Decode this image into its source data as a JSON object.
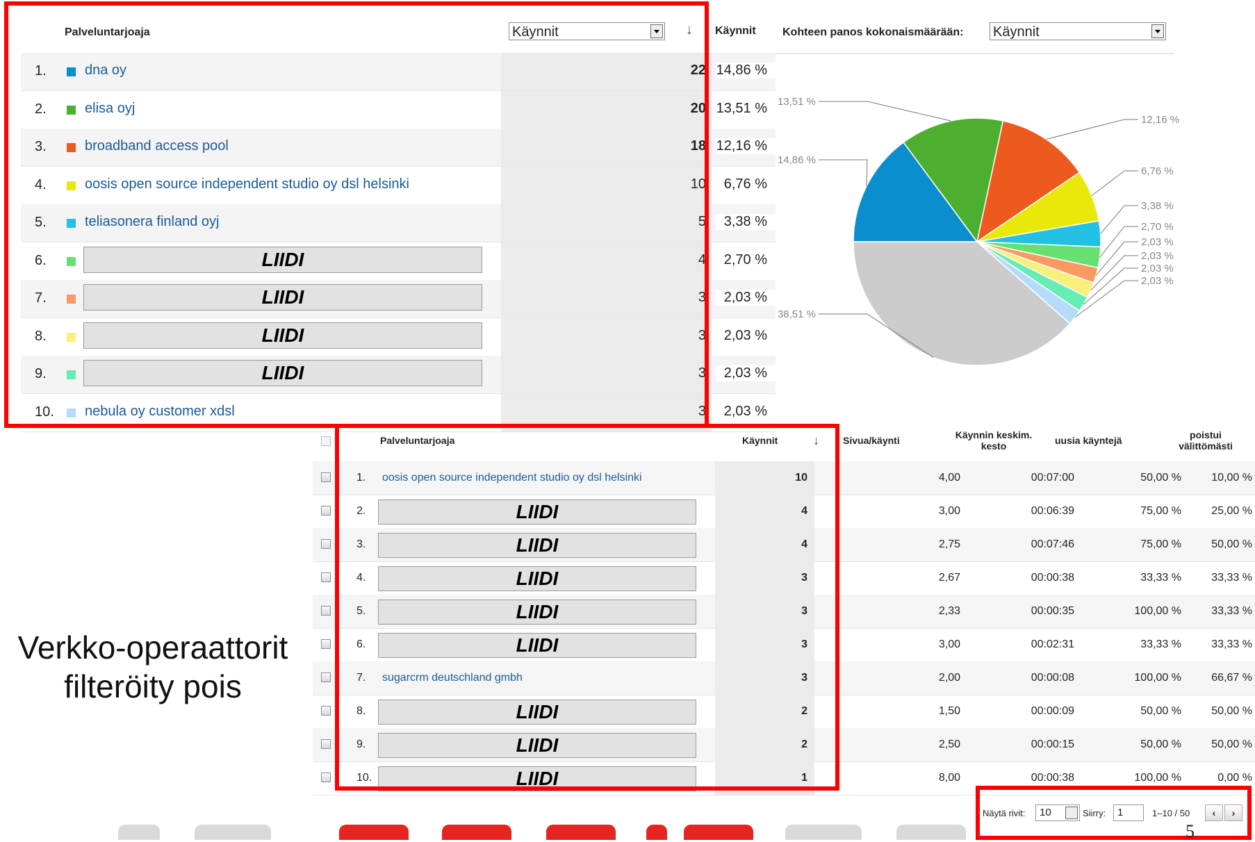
{
  "top": {
    "header": {
      "provider_col": "Palveluntarjoaja",
      "metric_select": "Käynnit",
      "visits_col": "Käynnit"
    },
    "rows": [
      {
        "num": "1.",
        "name": "dna oy",
        "visits": "22",
        "pct": "14,86 %",
        "color": "#0b8ecd",
        "hidden": false
      },
      {
        "num": "2.",
        "name": "elisa oyj",
        "visits": "20",
        "pct": "13,51 %",
        "color": "#4caf30",
        "hidden": false
      },
      {
        "num": "3.",
        "name": "broadband access pool",
        "visits": "18",
        "pct": "12,16 %",
        "color": "#ee5a1e",
        "hidden": false
      },
      {
        "num": "4.",
        "name": "oosis open source independent studio oy dsl helsinki",
        "visits": "10",
        "pct": "6,76 %",
        "color": "#e8e80a",
        "hidden": false
      },
      {
        "num": "5.",
        "name": "teliasonera finland oyj",
        "visits": "5",
        "pct": "3,38 %",
        "color": "#22c0e3",
        "hidden": false
      },
      {
        "num": "6.",
        "name": "LIIDI",
        "visits": "4",
        "pct": "2,70 %",
        "color": "#66e070",
        "hidden": true
      },
      {
        "num": "7.",
        "name": "LIIDI",
        "visits": "3",
        "pct": "2,03 %",
        "color": "#fa9a62",
        "hidden": true
      },
      {
        "num": "8.",
        "name": "LIIDI",
        "visits": "3",
        "pct": "2,03 %",
        "color": "#f8f07a",
        "hidden": true
      },
      {
        "num": "9.",
        "name": "LIIDI",
        "visits": "3",
        "pct": "2,03 %",
        "color": "#66ecb4",
        "hidden": true
      },
      {
        "num": "10.",
        "name": "nebula oy customer xdsl",
        "visits": "3",
        "pct": "2,03 %",
        "color": "#b4dcfa",
        "hidden": false
      }
    ]
  },
  "pie": {
    "header_label": "Kohteen panos kokonaismäärään:",
    "select_value": "Käynnit",
    "labels": [
      "14,86 %",
      "13,51 %",
      "12,16 %",
      "6,76 %",
      "3,38 %",
      "2,70 %",
      "2,03 %",
      "2,03 %",
      "2,03 %",
      "2,03 %",
      "38,51 %"
    ]
  },
  "chart_data": {
    "type": "pie",
    "title": "",
    "categories": [
      "dna oy",
      "elisa oyj",
      "broadband access pool",
      "oosis open source independent studio oy dsl helsinki",
      "teliasonera finland oyj",
      "LIIDI",
      "LIIDI",
      "LIIDI",
      "LIIDI",
      "nebula oy customer xdsl",
      ""
    ],
    "values": [
      14.86,
      13.51,
      12.16,
      6.76,
      3.38,
      2.7,
      2.03,
      2.03,
      2.03,
      2.03,
      38.51
    ],
    "colors": [
      "#0b8ecd",
      "#4caf30",
      "#ee5a1e",
      "#e8e80a",
      "#22c0e3",
      "#66e070",
      "#fa9a62",
      "#f8f07a",
      "#66ecb4",
      "#b4dcfa",
      "#cccccc"
    ]
  },
  "bottom": {
    "header": {
      "provider_col": "Palveluntarjoaja",
      "visits_col": "Käynnit",
      "pages_col": "Sivua/käynti",
      "duration_col_line1": "Käynnin keskim.",
      "duration_col_line2": "kesto",
      "new_col": "uusia käyntejä",
      "bounce_col_line1": "poistui",
      "bounce_col_line2": "välittömästi"
    },
    "rows": [
      {
        "num": "1.",
        "name": "oosis open source independent studio oy dsl helsinki",
        "hidden": false,
        "visits": "10",
        "pages": "4,00",
        "duration": "00:07:00",
        "new": "50,00 %",
        "bounce": "10,00 %"
      },
      {
        "num": "2.",
        "name": "LIIDI",
        "hidden": true,
        "visits": "4",
        "pages": "3,00",
        "duration": "00:06:39",
        "new": "75,00 %",
        "bounce": "25,00 %"
      },
      {
        "num": "3.",
        "name": "LIIDI",
        "hidden": true,
        "visits": "4",
        "pages": "2,75",
        "duration": "00:07:46",
        "new": "75,00 %",
        "bounce": "50,00 %"
      },
      {
        "num": "4.",
        "name": "LIIDI",
        "hidden": true,
        "visits": "3",
        "pages": "2,67",
        "duration": "00:00:38",
        "new": "33,33 %",
        "bounce": "33,33 %"
      },
      {
        "num": "5.",
        "name": "LIIDI",
        "hidden": true,
        "visits": "3",
        "pages": "2,33",
        "duration": "00:00:35",
        "new": "100,00 %",
        "bounce": "33,33 %"
      },
      {
        "num": "6.",
        "name": "LIIDI",
        "hidden": true,
        "visits": "3",
        "pages": "3,00",
        "duration": "00:02:31",
        "new": "33,33 %",
        "bounce": "33,33 %"
      },
      {
        "num": "7.",
        "name": "sugarcrm deutschland gmbh",
        "hidden": false,
        "visits": "3",
        "pages": "2,00",
        "duration": "00:00:08",
        "new": "100,00 %",
        "bounce": "66,67 %"
      },
      {
        "num": "8.",
        "name": "LIIDI",
        "hidden": true,
        "visits": "2",
        "pages": "1,50",
        "duration": "00:00:09",
        "new": "50,00 %",
        "bounce": "50,00 %"
      },
      {
        "num": "9.",
        "name": "LIIDI",
        "hidden": true,
        "visits": "2",
        "pages": "2,50",
        "duration": "00:00:15",
        "new": "50,00 %",
        "bounce": "50,00 %"
      },
      {
        "num": "10.",
        "name": "LIIDI",
        "hidden": true,
        "visits": "1",
        "pages": "8,00",
        "duration": "00:00:38",
        "new": "100,00 %",
        "bounce": "0,00 %"
      }
    ]
  },
  "pager": {
    "rows_label": "Näytä rivit:",
    "rows_value": "10",
    "goto_label": "Siirry:",
    "goto_value": "1",
    "range": "1–10 / 50",
    "prev": "‹",
    "next": "›"
  },
  "caption": {
    "line1": "Verkko-operaattorit",
    "line2": "filteröity pois"
  },
  "slide_number": "5"
}
